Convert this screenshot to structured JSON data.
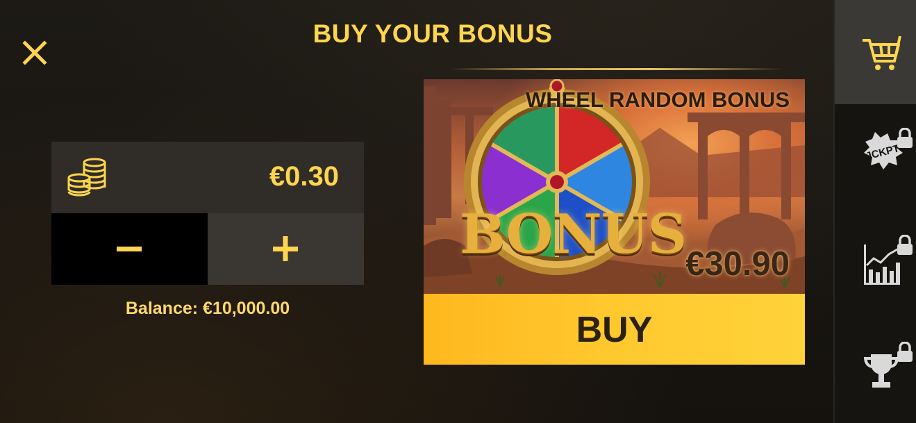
{
  "header": {
    "title": "BUY YOUR BONUS",
    "close_icon": "close-icon"
  },
  "bet": {
    "icon": "coins-icon",
    "value": "€0.30",
    "decrease_icon": "minus-icon",
    "increase_icon": "plus-icon",
    "balance": "Balance: €10,000.00"
  },
  "bonus_card": {
    "title": "WHEEL RANDOM BONUS",
    "logo_text": "BONUS",
    "price": "€30.90",
    "buy_label": "BUY"
  },
  "sidebar": {
    "items": [
      {
        "icon": "shopping-cart-icon",
        "active": true,
        "locked": false
      },
      {
        "icon": "jackpot-icon",
        "label": "JCKPT",
        "active": false,
        "locked": true
      },
      {
        "icon": "stats-chart-icon",
        "active": false,
        "locked": true
      },
      {
        "icon": "trophy-icon",
        "active": false,
        "locked": true
      }
    ]
  },
  "colors": {
    "accent_gold": "#ffd54f",
    "buy_button": "#ffc22b",
    "background": "#1b1712",
    "sidebar_active": "#3b3935"
  }
}
